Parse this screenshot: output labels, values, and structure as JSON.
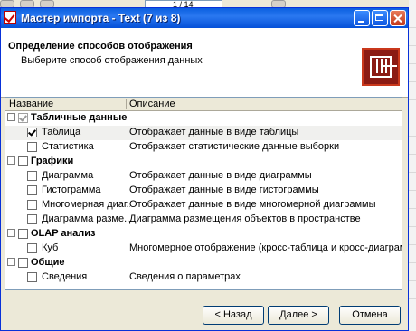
{
  "background": {
    "field_text": "1 / 14"
  },
  "window": {
    "title": "Мастер импорта - Text (7 из 8)",
    "heading": "Определение способов отображения",
    "subheading": "Выберите способ отображения данных"
  },
  "columns": {
    "name": "Название",
    "description": "Описание"
  },
  "groups": [
    {
      "label": "Табличные данные",
      "checked": true,
      "items": [
        {
          "name": "Таблица",
          "description": "Отображает данные в виде таблицы",
          "checked": true,
          "selected": true
        },
        {
          "name": "Статистика",
          "description": "Отображает статистические данные выборки",
          "checked": false
        }
      ]
    },
    {
      "label": "Графики",
      "checked": false,
      "items": [
        {
          "name": "Диаграмма",
          "description": "Отображает данные в виде диаграммы",
          "checked": false
        },
        {
          "name": "Гистограмма",
          "description": "Отображает данные в виде гистограммы",
          "checked": false
        },
        {
          "name": "Многомерная диаг...",
          "description": "Отображает данные в виде многомерной диаграммы",
          "checked": false
        },
        {
          "name": "Диаграмма разме...",
          "description": "Диаграмма размещения объектов в пространстве",
          "checked": false
        }
      ]
    },
    {
      "label": "OLAP анализ",
      "checked": false,
      "items": [
        {
          "name": "Куб",
          "description": "Многомерное отображение (кросс-таблица и кросс-диаграмма)",
          "checked": false
        }
      ]
    },
    {
      "label": "Общие",
      "checked": false,
      "items": [
        {
          "name": "Сведения",
          "description": "Сведения о параметрах",
          "checked": false
        }
      ]
    }
  ],
  "buttons": {
    "back": "< Назад",
    "next": "Далее >",
    "cancel": "Отмена"
  }
}
